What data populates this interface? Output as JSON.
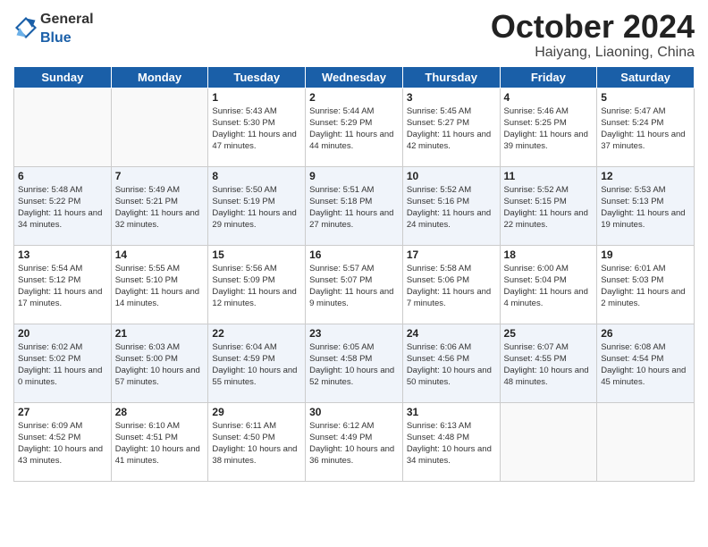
{
  "header": {
    "logo_general": "General",
    "logo_blue": "Blue",
    "title": "October 2024",
    "subtitle": "Haiyang, Liaoning, China"
  },
  "weekdays": [
    "Sunday",
    "Monday",
    "Tuesday",
    "Wednesday",
    "Thursday",
    "Friday",
    "Saturday"
  ],
  "weeks": [
    [
      {
        "day": null
      },
      {
        "day": null
      },
      {
        "day": "1",
        "sunrise": "5:43 AM",
        "sunset": "5:30 PM",
        "daylight": "11 hours and 47 minutes."
      },
      {
        "day": "2",
        "sunrise": "5:44 AM",
        "sunset": "5:29 PM",
        "daylight": "11 hours and 44 minutes."
      },
      {
        "day": "3",
        "sunrise": "5:45 AM",
        "sunset": "5:27 PM",
        "daylight": "11 hours and 42 minutes."
      },
      {
        "day": "4",
        "sunrise": "5:46 AM",
        "sunset": "5:25 PM",
        "daylight": "11 hours and 39 minutes."
      },
      {
        "day": "5",
        "sunrise": "5:47 AM",
        "sunset": "5:24 PM",
        "daylight": "11 hours and 37 minutes."
      }
    ],
    [
      {
        "day": "6",
        "sunrise": "5:48 AM",
        "sunset": "5:22 PM",
        "daylight": "11 hours and 34 minutes."
      },
      {
        "day": "7",
        "sunrise": "5:49 AM",
        "sunset": "5:21 PM",
        "daylight": "11 hours and 32 minutes."
      },
      {
        "day": "8",
        "sunrise": "5:50 AM",
        "sunset": "5:19 PM",
        "daylight": "11 hours and 29 minutes."
      },
      {
        "day": "9",
        "sunrise": "5:51 AM",
        "sunset": "5:18 PM",
        "daylight": "11 hours and 27 minutes."
      },
      {
        "day": "10",
        "sunrise": "5:52 AM",
        "sunset": "5:16 PM",
        "daylight": "11 hours and 24 minutes."
      },
      {
        "day": "11",
        "sunrise": "5:52 AM",
        "sunset": "5:15 PM",
        "daylight": "11 hours and 22 minutes."
      },
      {
        "day": "12",
        "sunrise": "5:53 AM",
        "sunset": "5:13 PM",
        "daylight": "11 hours and 19 minutes."
      }
    ],
    [
      {
        "day": "13",
        "sunrise": "5:54 AM",
        "sunset": "5:12 PM",
        "daylight": "11 hours and 17 minutes."
      },
      {
        "day": "14",
        "sunrise": "5:55 AM",
        "sunset": "5:10 PM",
        "daylight": "11 hours and 14 minutes."
      },
      {
        "day": "15",
        "sunrise": "5:56 AM",
        "sunset": "5:09 PM",
        "daylight": "11 hours and 12 minutes."
      },
      {
        "day": "16",
        "sunrise": "5:57 AM",
        "sunset": "5:07 PM",
        "daylight": "11 hours and 9 minutes."
      },
      {
        "day": "17",
        "sunrise": "5:58 AM",
        "sunset": "5:06 PM",
        "daylight": "11 hours and 7 minutes."
      },
      {
        "day": "18",
        "sunrise": "6:00 AM",
        "sunset": "5:04 PM",
        "daylight": "11 hours and 4 minutes."
      },
      {
        "day": "19",
        "sunrise": "6:01 AM",
        "sunset": "5:03 PM",
        "daylight": "11 hours and 2 minutes."
      }
    ],
    [
      {
        "day": "20",
        "sunrise": "6:02 AM",
        "sunset": "5:02 PM",
        "daylight": "11 hours and 0 minutes."
      },
      {
        "day": "21",
        "sunrise": "6:03 AM",
        "sunset": "5:00 PM",
        "daylight": "10 hours and 57 minutes."
      },
      {
        "day": "22",
        "sunrise": "6:04 AM",
        "sunset": "4:59 PM",
        "daylight": "10 hours and 55 minutes."
      },
      {
        "day": "23",
        "sunrise": "6:05 AM",
        "sunset": "4:58 PM",
        "daylight": "10 hours and 52 minutes."
      },
      {
        "day": "24",
        "sunrise": "6:06 AM",
        "sunset": "4:56 PM",
        "daylight": "10 hours and 50 minutes."
      },
      {
        "day": "25",
        "sunrise": "6:07 AM",
        "sunset": "4:55 PM",
        "daylight": "10 hours and 48 minutes."
      },
      {
        "day": "26",
        "sunrise": "6:08 AM",
        "sunset": "4:54 PM",
        "daylight": "10 hours and 45 minutes."
      }
    ],
    [
      {
        "day": "27",
        "sunrise": "6:09 AM",
        "sunset": "4:52 PM",
        "daylight": "10 hours and 43 minutes."
      },
      {
        "day": "28",
        "sunrise": "6:10 AM",
        "sunset": "4:51 PM",
        "daylight": "10 hours and 41 minutes."
      },
      {
        "day": "29",
        "sunrise": "6:11 AM",
        "sunset": "4:50 PM",
        "daylight": "10 hours and 38 minutes."
      },
      {
        "day": "30",
        "sunrise": "6:12 AM",
        "sunset": "4:49 PM",
        "daylight": "10 hours and 36 minutes."
      },
      {
        "day": "31",
        "sunrise": "6:13 AM",
        "sunset": "4:48 PM",
        "daylight": "10 hours and 34 minutes."
      },
      {
        "day": null
      },
      {
        "day": null
      }
    ]
  ]
}
